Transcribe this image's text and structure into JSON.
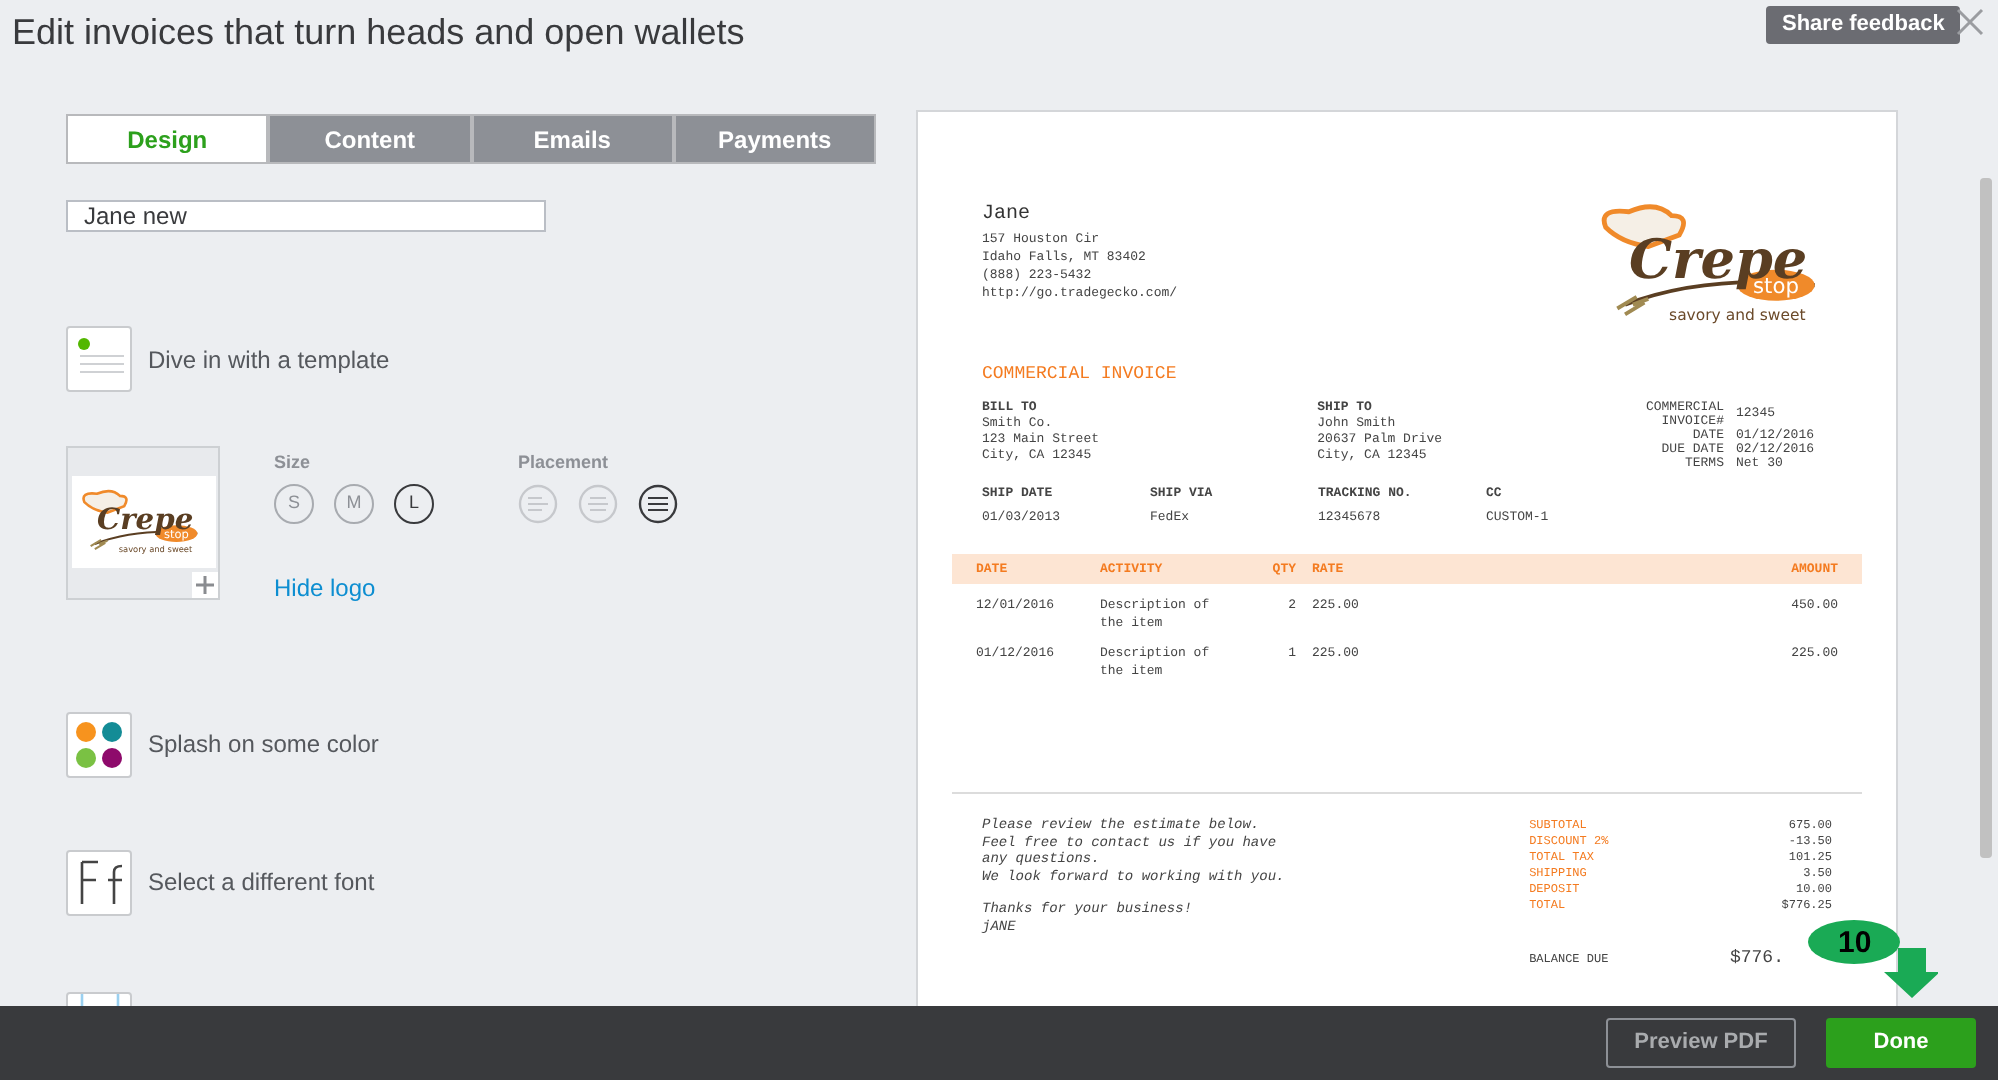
{
  "window": {
    "title": "Edit invoices that turn heads and open wallets",
    "feedback_button": "Share feedback"
  },
  "tabs": [
    {
      "label": "Design",
      "selected": true
    },
    {
      "label": "Content",
      "selected": false
    },
    {
      "label": "Emails",
      "selected": false
    },
    {
      "label": "Payments",
      "selected": false
    }
  ],
  "template_name": {
    "value": "Jane new"
  },
  "options": [
    {
      "kind": "template",
      "label": "Dive in with a template"
    },
    {
      "kind": "logo",
      "logo": {
        "name": "Crepe",
        "badge": "stop",
        "tagline": "savory and sweet"
      },
      "size_label": "Size",
      "sizes": [
        {
          "label": "S",
          "selected": false
        },
        {
          "label": "M",
          "selected": false
        },
        {
          "label": "L",
          "selected": true
        }
      ],
      "placement_label": "Placement",
      "placements": [
        {
          "selected": false
        },
        {
          "selected": false
        },
        {
          "selected": true
        }
      ],
      "link": "Hide logo"
    },
    {
      "kind": "color",
      "label": "Splash on some color",
      "swatches": [
        {
          "color": "#f7931e"
        },
        {
          "color": "#138c96"
        },
        {
          "color": "#7ac143"
        },
        {
          "color": "#8e0a6b"
        }
      ]
    },
    {
      "kind": "font",
      "label": "Select a different font"
    },
    {
      "kind": "partial"
    }
  ],
  "invoice": {
    "company": "Jane",
    "address": [
      "157 Houston Cir",
      "Idaho Falls, MT 83402",
      "(888) 223-5432",
      "http://go.tradegecko.com/"
    ],
    "logo": {
      "name": "Crepe",
      "badge": "stop",
      "tagline": "savory and sweet"
    },
    "title": "COMMERCIAL INVOICE",
    "bill_to": {
      "label": "BILL TO",
      "lines": [
        "Smith Co.",
        "123 Main Street",
        "City, CA 12345"
      ]
    },
    "ship_to": {
      "label": "SHIP TO",
      "lines": [
        "John Smith",
        "20637 Palm Drive",
        "City, CA 12345"
      ]
    },
    "meta": [
      {
        "label": "COMMERCIAL INVOICE#",
        "value": "12345"
      },
      {
        "label": "DATE",
        "value": "01/12/2016"
      },
      {
        "label": "DUE DATE",
        "value": "02/12/2016"
      },
      {
        "label": "TERMS",
        "value": "Net 30"
      }
    ],
    "shipping": [
      {
        "label": "SHIP DATE",
        "value": "01/03/2013"
      },
      {
        "label": "SHIP VIA",
        "value": "FedEx"
      },
      {
        "label": "TRACKING NO.",
        "value": "12345678"
      },
      {
        "label": "CC",
        "value": "CUSTOM-1"
      }
    ],
    "columns": [
      "DATE",
      "ACTIVITY",
      "QTY",
      "RATE",
      "AMOUNT"
    ],
    "rows": [
      [
        "12/01/2016",
        "Description of the item",
        "2",
        "225.00",
        "450.00"
      ],
      [
        "01/12/2016",
        "Description of the item",
        "1",
        "225.00",
        "225.00"
      ]
    ],
    "message": [
      "Please review the estimate below.",
      "Feel free to contact us if you have",
      "any questions.",
      "We look forward to working with you."
    ],
    "thanks": [
      "Thanks for your business!",
      "jANE"
    ],
    "totals": [
      {
        "label": "SUBTOTAL",
        "value": "675.00"
      },
      {
        "label": "DISCOUNT 2%",
        "value": "-13.50"
      },
      {
        "label": "TOTAL TAX",
        "value": "101.25"
      },
      {
        "label": "SHIPPING",
        "value": "3.50"
      },
      {
        "label": "DEPOSIT",
        "value": "10.00"
      },
      {
        "label": "TOTAL",
        "value": "$776.25"
      }
    ],
    "balance": {
      "label": "BALANCE DUE",
      "value": "$776."
    }
  },
  "callout": {
    "label": "10"
  },
  "footer": {
    "buttons": [
      {
        "kind": "secondary",
        "label": "Preview PDF"
      },
      {
        "kind": "primary",
        "label": "Done"
      }
    ]
  }
}
